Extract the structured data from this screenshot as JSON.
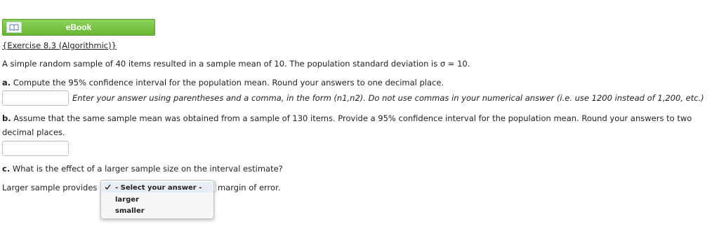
{
  "ebook": {
    "label": "eBook",
    "icon": "book-icon"
  },
  "exercise_title": "{Exercise 8.3 (Algorithmic)}",
  "intro": "A simple random sample of 40 items resulted in a sample mean of 10. The population standard deviation is σ = 10.",
  "part_a": {
    "letter": "a.",
    "question": "Compute the 95% confidence interval for the population mean. Round your answers to one decimal place.",
    "answer_value": "",
    "hint": "Enter your answer using parentheses and a comma, in the form (n1,n2). Do not use commas in your numerical answer (i.e. use 1200 instead of 1,200, etc.)"
  },
  "part_b": {
    "letter": "b.",
    "question_line1": "Assume that the same sample mean was obtained from a sample of 130 items. Provide a 95% confidence interval for the population mean. Round your answers to two",
    "question_line2": "decimal places.",
    "answer_value": ""
  },
  "part_c": {
    "letter": "c.",
    "question": "What is the effect of a larger sample size on the interval estimate?",
    "prefix": "Larger sample provides",
    "suffix": "margin of error.",
    "dropdown": {
      "selected": "- Select your answer -",
      "options": [
        "- Select your answer -",
        "larger",
        "smaller"
      ]
    }
  }
}
